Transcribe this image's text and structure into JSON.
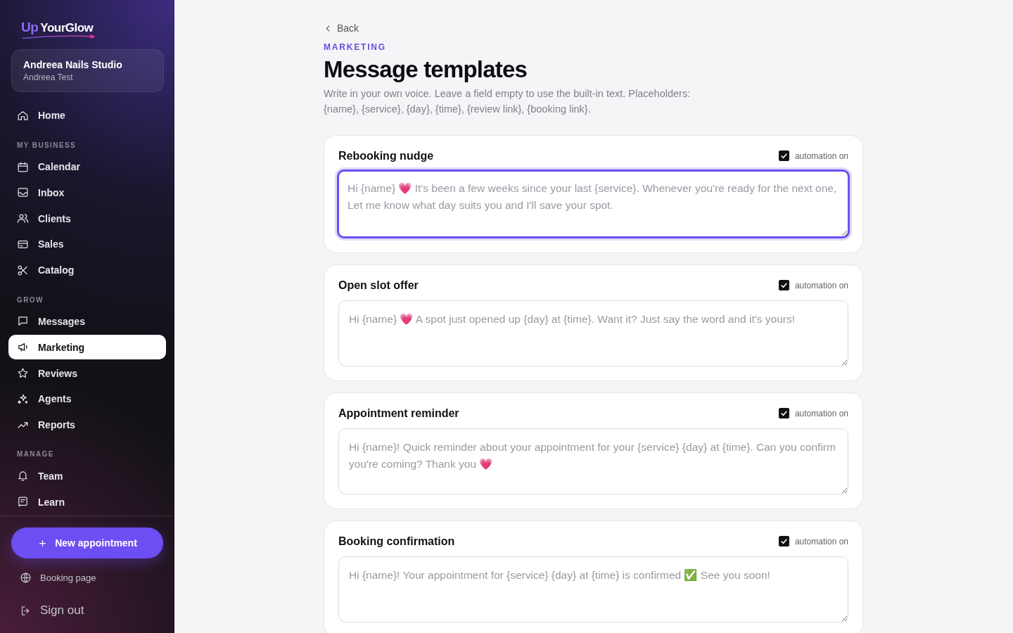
{
  "brand": {
    "prefix": "Up",
    "name": "YourGlow"
  },
  "account": {
    "business": "Andreea Nails Studio",
    "user": "Andreea Test"
  },
  "nav": [
    {
      "kind": "item",
      "label": "Home",
      "selected": false
    },
    {
      "kind": "heading",
      "label": "MY BUSINESS"
    },
    {
      "kind": "item",
      "label": "Calendar",
      "selected": false
    },
    {
      "kind": "item",
      "label": "Inbox",
      "selected": false
    },
    {
      "kind": "item",
      "label": "Clients",
      "selected": false
    },
    {
      "kind": "item",
      "label": "Sales",
      "selected": false
    },
    {
      "kind": "item",
      "label": "Catalog",
      "selected": false
    },
    {
      "kind": "heading",
      "label": "GROW"
    },
    {
      "kind": "item",
      "label": "Messages",
      "selected": false
    },
    {
      "kind": "item",
      "label": "Marketing",
      "selected": true
    },
    {
      "kind": "item",
      "label": "Reviews",
      "selected": false
    },
    {
      "kind": "item",
      "label": "Agents",
      "selected": false
    },
    {
      "kind": "item",
      "label": "Reports",
      "selected": false
    },
    {
      "kind": "heading",
      "label": "MANAGE"
    },
    {
      "kind": "item",
      "label": "Team",
      "selected": false
    },
    {
      "kind": "item",
      "label": "Learn",
      "selected": false
    }
  ],
  "new_button": "New appointment",
  "footer_links": [
    "Booking page",
    "Sign out"
  ],
  "back": "Back",
  "eyebrow": "MARKETING",
  "title": "Message templates",
  "description": "Write in your own voice. Leave a field empty to use the built-in text. Placeholders: {name}, {service}, {day}, {time}, {review link}, {booking link}.",
  "templates": [
    {
      "title": "Rebooking nudge",
      "automation_label": "automation on",
      "checked": true,
      "focused": true,
      "placeholder": "Hi {name} 💗 It's been a few weeks since your last {service}. Whenever you're ready for the next one, Let me know what day suits you and I'll save your spot."
    },
    {
      "title": "Open slot offer",
      "automation_label": "automation on",
      "checked": true,
      "focused": false,
      "placeholder": "Hi {name} 💗 A spot just opened up {day} at {time}. Want it? Just say the word and it's yours!"
    },
    {
      "title": "Appointment reminder",
      "automation_label": "automation on",
      "checked": true,
      "focused": false,
      "placeholder": "Hi {name}! Quick reminder about your appointment for your {service} {day} at {time}. Can you confirm you're coming? Thank you 💗"
    },
    {
      "title": "Booking confirmation",
      "automation_label": "automation on",
      "checked": true,
      "focused": false,
      "placeholder": "Hi {name}! Your appointment for {service} {day} at {time} is confirmed ✅ See you soon!"
    }
  ]
}
